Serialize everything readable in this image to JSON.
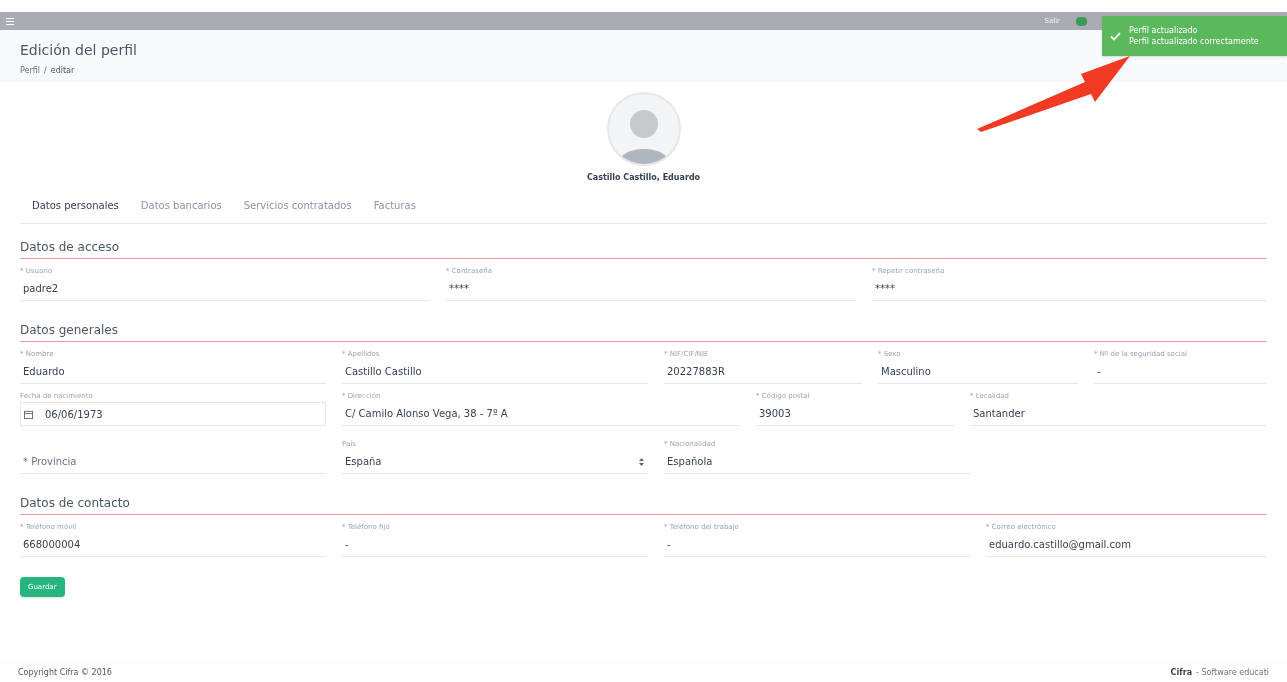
{
  "topbar": {
    "logout": "Salir"
  },
  "header": {
    "title": "Edición del perfil",
    "breadcrumb": [
      "Perfil",
      "editar"
    ],
    "separator": "/"
  },
  "toast": {
    "title": "Perfil actualizado",
    "message": "Perfil actualizado correctamente"
  },
  "profile": {
    "name": "Castillo Castillo, Eduardo"
  },
  "tabs": [
    {
      "label": "Datos personales",
      "selected": true
    },
    {
      "label": "Datos bancarios",
      "selected": false
    },
    {
      "label": "Servicios contratados",
      "selected": false
    },
    {
      "label": "Facturas",
      "selected": false
    }
  ],
  "sections": [
    {
      "title": "Datos de acceso",
      "rows": [
        {
          "fields": [
            {
              "kind": "text",
              "label": "* Usuario",
              "value": "padre2"
            },
            {
              "kind": "text",
              "label": "* Contraseña",
              "value": "****"
            },
            {
              "kind": "text",
              "label": "* Repetir contraseña",
              "value": "****"
            }
          ]
        }
      ]
    },
    {
      "title": "Datos generales",
      "rows": [
        {
          "fields": [
            {
              "kind": "text",
              "label": "* Nombre",
              "value": "Eduardo"
            },
            {
              "kind": "text",
              "label": "* Apellidos",
              "value": "Castillo Castillo"
            },
            {
              "kind": "text",
              "label": "* NIF/CIF/NIE",
              "value": "20227883R"
            },
            {
              "kind": "text",
              "label": "* Sexo",
              "value": "Masculino"
            },
            {
              "kind": "text",
              "label": "* Nº de la seguridad social",
              "value": "-"
            }
          ]
        },
        {
          "fields": [
            {
              "kind": "date",
              "label": "Fecha de nacimiento",
              "value": "06/06/1973"
            },
            {
              "kind": "text",
              "label": "* Dirección",
              "value": "C/ Camilo Alonso Vega, 38 - 7º A"
            },
            {
              "kind": "text",
              "label": "* Código postal",
              "value": "39003"
            },
            {
              "kind": "text",
              "label": "* Localidad",
              "value": "Santander"
            }
          ]
        },
        {
          "fields": [
            {
              "kind": "empty",
              "placeholder": "* Provincia"
            },
            {
              "kind": "select",
              "label": "País",
              "value": "España"
            },
            {
              "kind": "text",
              "label": "* Nacionalidad",
              "value": "Española"
            }
          ]
        }
      ]
    },
    {
      "title": "Datos de contacto",
      "rows": [
        {
          "fields": [
            {
              "kind": "text",
              "label": "* Teléfono móvil",
              "value": "668000004"
            },
            {
              "kind": "text",
              "label": "* Teléfono fijo",
              "value": "-"
            },
            {
              "kind": "text",
              "label": "* Teléfono del trabajo",
              "value": "-"
            },
            {
              "kind": "text",
              "label": "* Correo electrónico",
              "value": "eduardo.castillo@gmail.com"
            }
          ]
        }
      ]
    }
  ],
  "save_button": "Guardar",
  "footer": {
    "copyright": "Copyright Cifra © 2016",
    "brand": "Cifra",
    "tagline": "- Software educati"
  }
}
